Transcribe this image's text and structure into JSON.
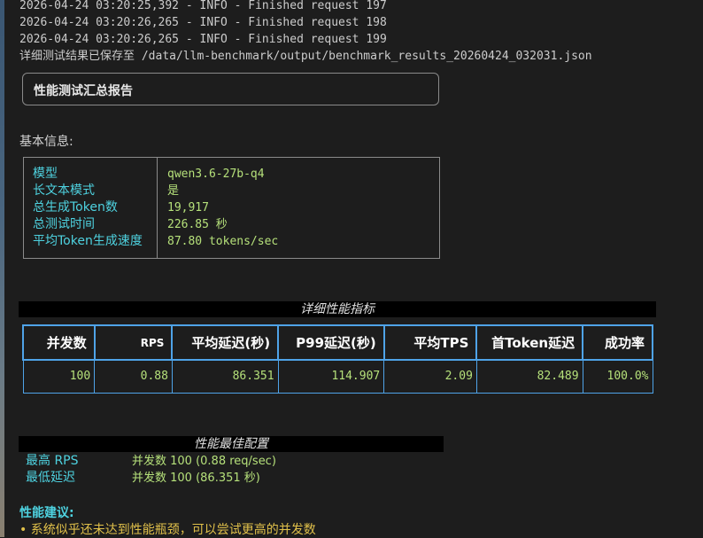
{
  "log": {
    "lines": [
      "2026-04-24 03:20:25,392 - INFO - Finished request 197",
      "2026-04-24 03:20:26,265 - INFO - Finished request 198",
      "2026-04-24 03:20:26,265 - INFO - Finished request 199"
    ],
    "saved_prefix": "详细测试结果已保存至",
    "saved_path": " /data/llm-benchmark/output/benchmark_results_20260424_032031.json"
  },
  "report": {
    "title": "性能测试汇总报告",
    "basic_label": "基本信息:",
    "basic_info": [
      {
        "key": "模型",
        "value": "qwen3.6-27b-q4"
      },
      {
        "key": "长文本模式",
        "value": "是"
      },
      {
        "key": "总生成Token数",
        "value": "19,917"
      },
      {
        "key": "总测试时间",
        "value": "226.85 秒"
      },
      {
        "key": "平均Token生成速度",
        "value": "87.80 tokens/sec"
      }
    ]
  },
  "metrics": {
    "title": "详细性能指标",
    "headers": [
      "并发数",
      "RPS",
      "平均延迟(秒)",
      "P99延迟(秒)",
      "平均TPS",
      "首Token延迟",
      "成功率"
    ],
    "rows": [
      [
        "100",
        "0.88",
        "86.351",
        "114.907",
        "2.09",
        "82.489",
        "100.0%"
      ]
    ]
  },
  "best": {
    "title": "性能最佳配置",
    "items": [
      {
        "key": "最高 RPS",
        "value": "并发数 100 (0.88 req/sec)"
      },
      {
        "key": "最低延迟",
        "value": "并发数 100 (86.351 秒)"
      }
    ]
  },
  "advice": {
    "title": "性能建议:",
    "items": [
      "• 系统似乎还未达到性能瓶颈，可以尝试更高的并发数"
    ]
  },
  "colors": {
    "cyan": "#4ed2e0",
    "green": "#b5e07a",
    "blue_border": "#4fa3e8",
    "yellow": "#e0c04a"
  }
}
